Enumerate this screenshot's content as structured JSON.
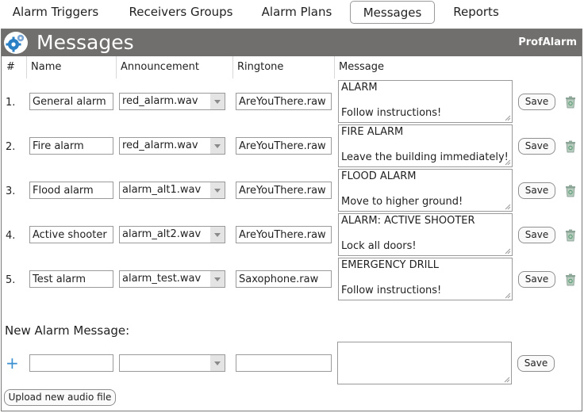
{
  "tabs": [
    {
      "label": "Alarm Triggers"
    },
    {
      "label": "Receivers Groups"
    },
    {
      "label": "Alarm Plans"
    },
    {
      "label": "Messages",
      "active": true
    },
    {
      "label": "Reports"
    }
  ],
  "header": {
    "title": "Messages",
    "brand": "ProfAlarm",
    "color": "#706f6d"
  },
  "columns": {
    "num": "#",
    "name": "Name",
    "announcement": "Announcement",
    "ringtone": "Ringtone",
    "message": "Message"
  },
  "rows": [
    {
      "num": "1.",
      "name": "General alarm",
      "announcement": "red_alarm.wav",
      "ringtone": "AreYouThere.raw",
      "message_line1": "ALARM",
      "message_line2": "Follow instructions!",
      "save": "Save"
    },
    {
      "num": "2.",
      "name": "Fire alarm",
      "announcement": "red_alarm.wav",
      "ringtone": "AreYouThere.raw",
      "message_line1": "FIRE ALARM",
      "message_line2": "Leave the building immediately!",
      "save": "Save"
    },
    {
      "num": "3.",
      "name": "Flood alarm",
      "announcement": "alarm_alt1.wav",
      "ringtone": "AreYouThere.raw",
      "message_line1": "FLOOD ALARM",
      "message_line2": "Move to higher ground!",
      "save": "Save"
    },
    {
      "num": "4.",
      "name": "Active shooter",
      "announcement": "alarm_alt2.wav",
      "ringtone": "AreYouThere.raw",
      "message_line1": "ALARM: ACTIVE SHOOTER",
      "message_line2": "Lock all doors!",
      "save": "Save"
    },
    {
      "num": "5.",
      "name": "Test alarm",
      "announcement": "alarm_test.wav",
      "ringtone": "Saxophone.raw",
      "message_line1": "EMERGENCY DRILL",
      "message_line2": "Follow instructions!",
      "save": "Save"
    }
  ],
  "new_message": {
    "label": "New Alarm Message:",
    "name": "",
    "announcement": "",
    "ringtone": "",
    "message": "",
    "save": "Save"
  },
  "upload": {
    "label": "Upload new audio file"
  },
  "icons": {
    "logo": "gears-icon",
    "trash": "trash-icon",
    "add": "plus-icon"
  }
}
